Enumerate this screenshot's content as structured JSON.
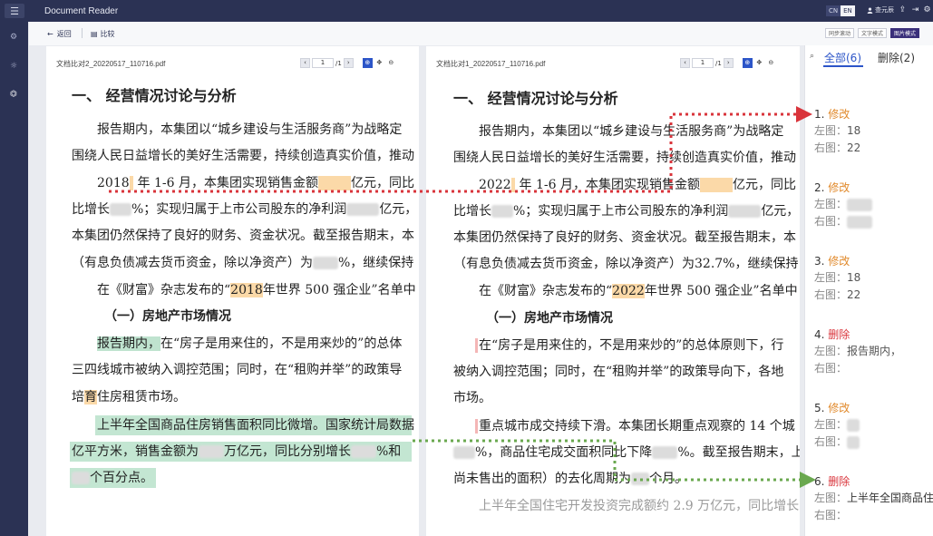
{
  "app": {
    "title": "Document Reader",
    "menu_glyph": "☰"
  },
  "topbar": {
    "lang_cn": "CN",
    "lang_en": "EN",
    "user_name": "查元辰",
    "icon_export": "⇪",
    "icon_logout": "⇥",
    "icon_settings": "⚙"
  },
  "rail": {
    "icon1": "⚙",
    "icon2": "☼",
    "icon3": "⏣"
  },
  "toolbar": {
    "back_label": "返回",
    "back_icon": "←",
    "compare_icon": "▤",
    "compare_label": "比较",
    "mode_sync": "同步滚动",
    "mode_text": "文字模式",
    "mode_image": "图片模式"
  },
  "left_doc": {
    "file_name": "文档比对2_20220517_110716.pdf",
    "page": "1",
    "total": "/1",
    "lines": {
      "l1": "一、 经营情况讨论与分析",
      "l2": "报告期内，本集团以“城乡建设与生活服务商”为战略定",
      "l3": "围绕人民日益增长的美好生活需要，持续创造真实价值，推动",
      "l4a": "2018",
      "l4b": " 年 1-6 月，本集团实现销售金额",
      "l4c": "亿元，同比",
      "l5a": "比增长",
      "l5b": "%；实现归属于上市公司股东的净利润",
      "l5c": "亿元，",
      "l6": "本集团仍然保持了良好的财务、资金状况。截至报告期末，本",
      "l7a": "（有息负债减去货币资金，除以净资产）为",
      "l7b": "%，继续保持",
      "l8a": "在《财富》杂志发布的“",
      "l8b": "2018",
      "l8c": "年世界 500 强企业”名单中",
      "l9": "（一）房地产市场情况",
      "l10a": "报告期内，",
      "l10b": "在“房子是用来住的，不是用来炒的”的总体",
      "l11": "三四线城市被纳入调控范围；同时，在“租购并举”的政策导",
      "l12a": "培",
      "l12b": "育",
      "l12c": "住房租赁市场。",
      "l13": "上半年全国商品住房销售面积同比微增。国家统计局数据",
      "l14a": "亿平方米，销售金额为",
      "l14b": "万亿元，同比分别增长",
      "l14c": "%和",
      "l15": "个百分点。"
    }
  },
  "right_doc": {
    "file_name": "文档比对1_20220517_110716.pdf",
    "page": "1",
    "total": "/1",
    "lines": {
      "r1": "一、 经营情况讨论与分析",
      "r2": "报告期内，本集团以“城乡建设与生活服务商”为战略定",
      "r3": "围绕人民日益增长的美好生活需要，持续创造真实价值，推动",
      "r4a": "2022",
      "r4b": " 年 1-6 月，本集团实现销售金额",
      "r4c": "亿元，同比",
      "r5a": "比增长",
      "r5b": "%；实现归属于上市公司股东的净利润",
      "r5c": "亿元，",
      "r6": "本集团仍然保持了良好的财务、资金状况。截至报告期末，本",
      "r7": "（有息负债减去货币资金，除以净资产）为32.7%，继续保持",
      "r8a": "在《财富》杂志发布的“",
      "r8b": "2022",
      "r8c": "年世界 500 强企业”名单中",
      "r9": "（一）房地产市场情况",
      "r10": "在“房子是用来住的，不是用来炒的”的总体原则下，行",
      "r11": "被纳入调控范围；同时，在“租购并举”的政策导向下，各地",
      "r12": "市场。",
      "r13": "重点城市成交持续下滑。本集团长期重点观察的 14 个城",
      "r14a": "%，商品住宅成交面积同比下降",
      "r14b": "%。截至报告期末，上",
      "r15a": "尚未售出的面积）的去化周期为",
      "r15b": "个月。",
      "r16": "上半年全国住宅开发投资完成额约 2.9 万亿元，同比增长"
    }
  },
  "changes": {
    "search_icon": "⌕",
    "tab_all": "全部(6)",
    "tab_deleted": "删除(2)",
    "items": [
      {
        "num": "1.",
        "kind": "修改",
        "left_label": "左图：",
        "left_val": "18",
        "right_label": "右图：",
        "right_val": "22"
      },
      {
        "num": "2.",
        "kind": "修改",
        "left_label": "左图：",
        "left_val": "",
        "right_label": "右图：",
        "right_val": ""
      },
      {
        "num": "3.",
        "kind": "修改",
        "left_label": "左图：",
        "left_val": "18",
        "right_label": "右图：",
        "right_val": "22"
      },
      {
        "num": "4.",
        "kind": "删除",
        "left_label": "左图：",
        "left_val": "报告期内，",
        "right_label": "右图：",
        "right_val": ""
      },
      {
        "num": "5.",
        "kind": "修改",
        "left_label": "左图：",
        "left_val": "",
        "right_label": "右图：",
        "right_val": ""
      },
      {
        "num": "6.",
        "kind": "删除",
        "left_label": "左图：",
        "left_val": "上半年全国商品住",
        "right_label": "右图：",
        "right_val": ""
      }
    ]
  },
  "colors": {
    "navy": "#2b3254",
    "accent_blue": "#2c55c8",
    "modify_orange": "#e18a2c",
    "delete_red": "#d9343b",
    "arrow_red": "#d9343b",
    "arrow_green": "#6aa84f"
  }
}
